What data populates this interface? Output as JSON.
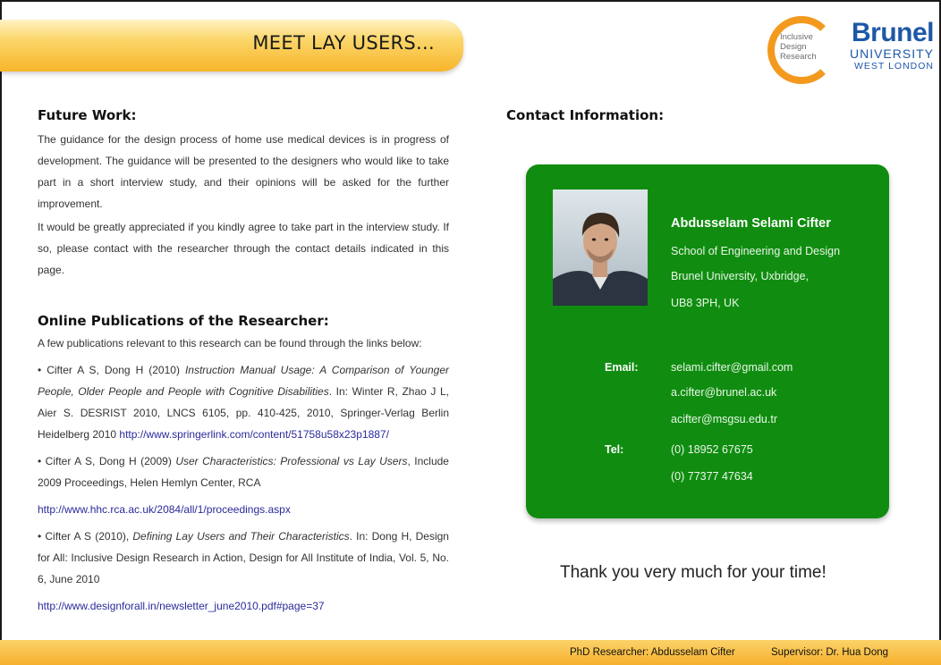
{
  "header": {
    "title": "MEET LAY USERS..."
  },
  "logos": {
    "idr": {
      "line1": "Inclusive",
      "line2": "Design",
      "line3": "Research"
    },
    "brunel": {
      "name": "Brunel",
      "sub1": "UNIVERSITY",
      "sub2": "WEST LONDON"
    }
  },
  "future": {
    "heading": "Future Work:",
    "p1": "The guidance for the design process of home use medical devices is in progress of development. The guidance will be presented to the designers who would like to take part in a short interview study, and their opinions will be asked for the further improvement.",
    "p2": "It would be greatly appreciated if you kindly agree to take part in the interview study. If so, please contact with the researcher through the contact details indicated in this page."
  },
  "publications": {
    "heading": "Online Publications of the Researcher:",
    "intro": "A few publications relevant to this research can be found through the links below:",
    "items": [
      {
        "prefix": "• Cifter A S, Dong H (2010) ",
        "title": "Instruction Manual Usage: A Comparison of Younger People, Older People and People with Cognitive Disabilities",
        "rest": ". In: Winter R, Zhao J L, Aier S. DESRIST 2010, LNCS 6105, pp. 410-425, 2010, Springer-Verlag Berlin Heidelberg 2010 ",
        "link": "http://www.springerlink.com/content/51758u58x23p1887/"
      },
      {
        "prefix": "• Cifter A S, Dong H (2009) ",
        "title": "User Characteristics: Professional vs Lay Users",
        "rest": ", Include 2009 Proceedings, Helen Hemlyn Center, RCA",
        "link": "http://www.hhc.rca.ac.uk/2084/all/1/proceedings.aspx"
      },
      {
        "prefix": "• Cifter A S (2010), ",
        "title": "Defining Lay Users and Their Characteristics",
        "rest": ". In: Dong H, Design for All: Inclusive Design Research in Action, Design for All Institute of India, Vol. 5, No. 6, June 2010",
        "link": "http://www.designforall.in/newsletter_june2010.pdf#page=37"
      }
    ]
  },
  "contact": {
    "heading": "Contact Information:",
    "name": "Abdusselam Selami Cifter",
    "address": [
      "School of Engineering and Design",
      "Brunel University, Uxbridge,",
      "UB8 3PH, UK"
    ],
    "email_label": "Email:",
    "emails": [
      "selami.cifter@gmail.com",
      "a.cifter@brunel.ac.uk",
      "acifter@msgsu.edu.tr"
    ],
    "tel_label": "Tel:",
    "tels": [
      "(0) 18952 67675",
      "(0) 77377 47634"
    ]
  },
  "thanks": "Thank you very much for your time!",
  "footer": {
    "researcher": "PhD Researcher: Abdusselam Cifter",
    "supervisor": "Supervisor: Dr. Hua Dong"
  },
  "colors": {
    "accent": "#f7b52a",
    "card": "#108d10",
    "link": "#2a2a9c",
    "brand": "#1d58a7"
  }
}
